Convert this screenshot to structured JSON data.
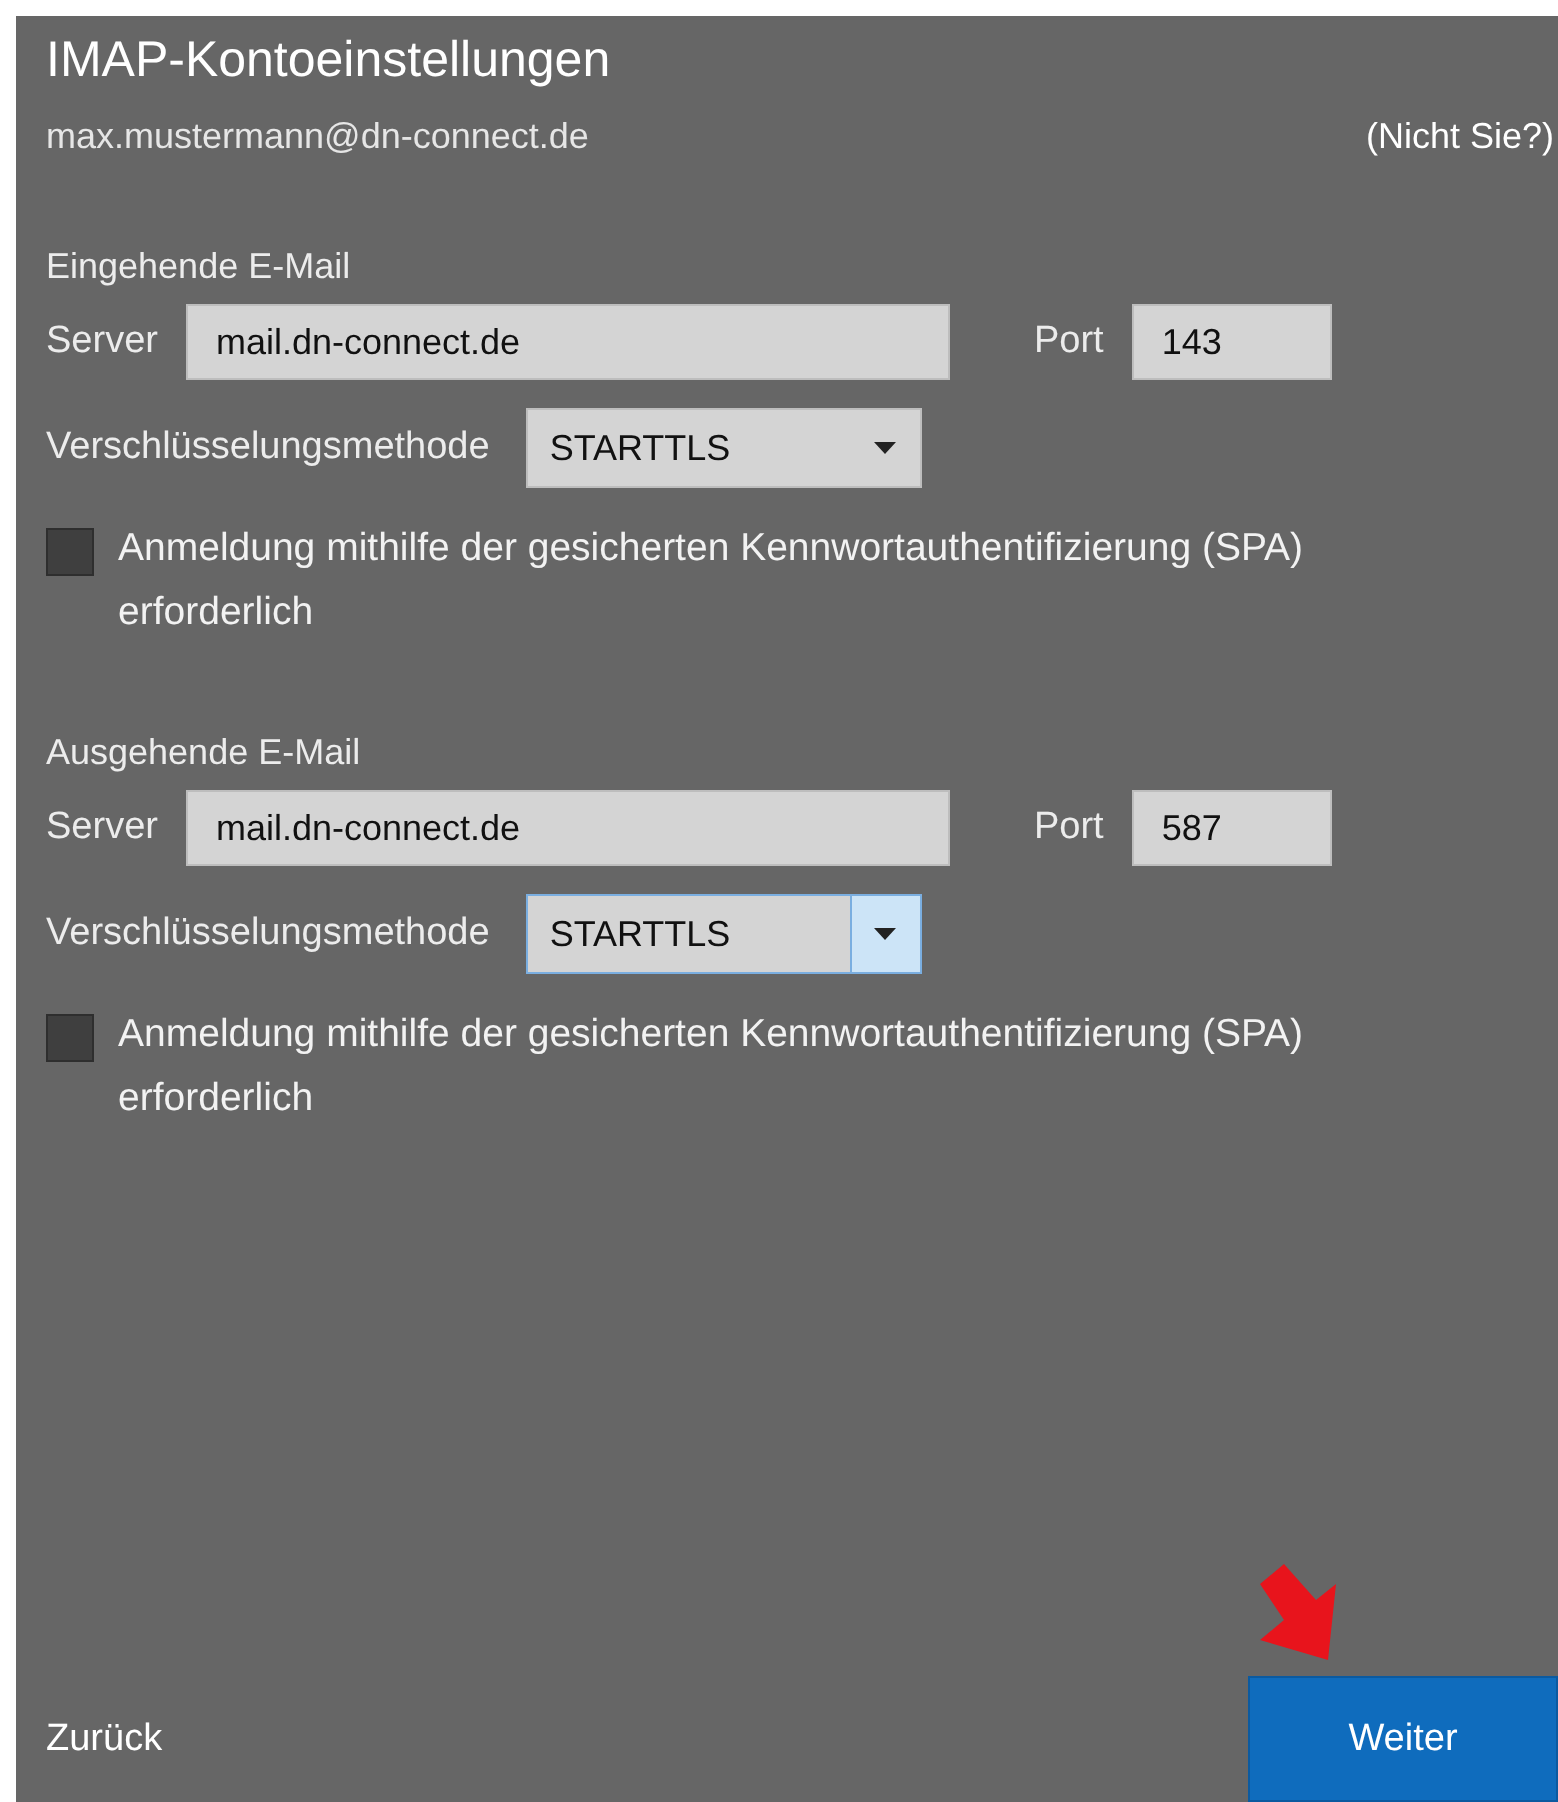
{
  "window": {
    "title": "IMAP-Kontoeinstellungen"
  },
  "account": {
    "email": "max.mustermann@dn-connect.de",
    "not_you_link": "(Nicht Sie?)"
  },
  "sections": [
    {
      "heading": "Eingehende E-Mail",
      "server_label": "Server",
      "server": "mail.dn-connect.de",
      "port_label": "Port",
      "port": "143",
      "encryption_label": "Verschlüsselungsmethode",
      "encryption": "STARTTLS",
      "encryption_focused": false,
      "spa_label": "Anmeldung mithilfe der gesicherten Kennwortauthentifizierung (SPA) erforderlich",
      "spa_checked": false
    },
    {
      "heading": "Ausgehende E-Mail",
      "server_label": "Server",
      "server": "mail.dn-connect.de",
      "port_label": "Port",
      "port": "587",
      "encryption_label": "Verschlüsselungsmethode",
      "encryption": "STARTTLS",
      "encryption_focused": true,
      "spa_label": "Anmeldung mithilfe der gesicherten Kennwortauthentifizierung (SPA) erforderlich",
      "spa_checked": false
    }
  ],
  "buttons": {
    "back": "Zurück",
    "next": "Weiter"
  }
}
